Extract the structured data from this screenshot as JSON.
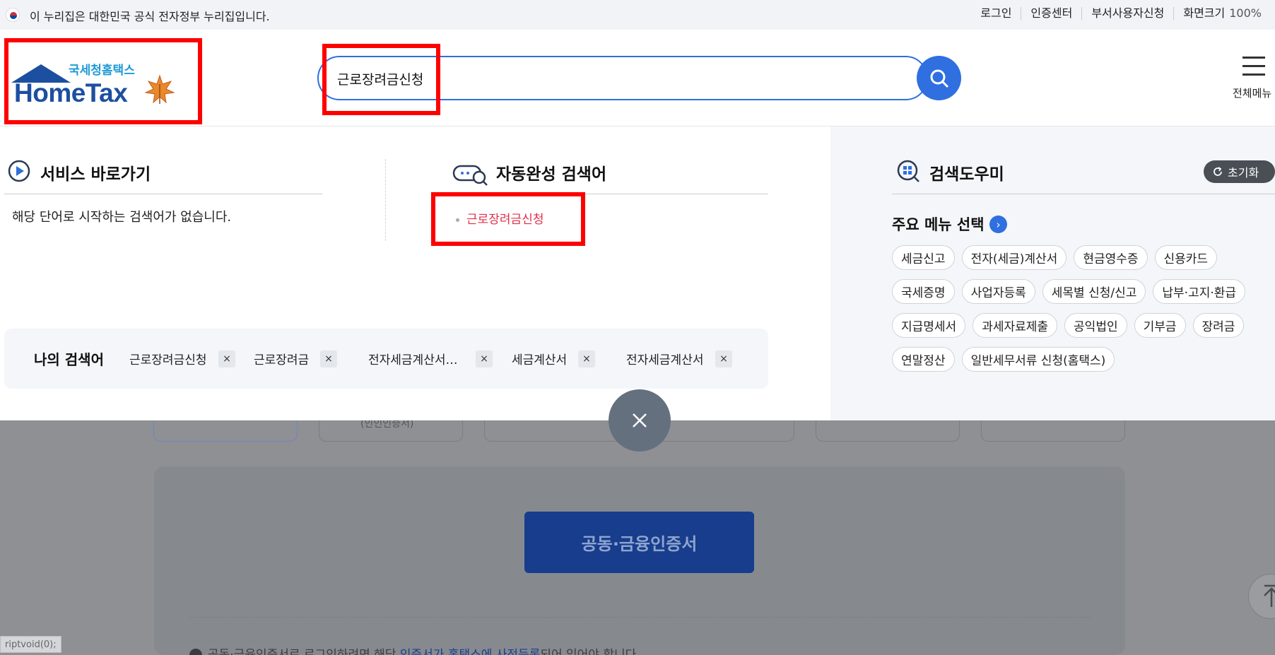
{
  "gov_banner": {
    "text": "이 누리집은 대한민국 공식 전자정부 누리집입니다.",
    "links": [
      "로그인",
      "인증센터",
      "부서사용자신청",
      "화면크기"
    ],
    "zoom": "100%"
  },
  "header": {
    "logo_sub": "국세청홈택스",
    "logo_main": "HomeTax",
    "search_value": "근로장려금신청",
    "menu_label": "전체메뉴"
  },
  "service": {
    "title": "서비스 바로가기",
    "empty_message": "해당 단어로 시작하는 검색어가 없습니다."
  },
  "autocomplete": {
    "title": "자동완성 검색어",
    "items": [
      "근로장려금신청"
    ]
  },
  "helper": {
    "title": "검색도우미",
    "reset_label": "초기화",
    "main_menu_title": "주요 메뉴 선택",
    "chips": [
      "세금신고",
      "전자(세금)계산서",
      "현금영수증",
      "신용카드",
      "국세증명",
      "사업자등록",
      "세목별 신청/신고",
      "납부·고지·환급",
      "지급명세서",
      "과세자료제출",
      "공익법인",
      "기부금",
      "장려금",
      "연말정산",
      "일반세무서류 신청(홈택스)"
    ]
  },
  "my_search": {
    "title": "나의 검색어",
    "items": [
      "근로장려금신청",
      "근로장려금",
      "전자세금계산서…",
      "세금계산서",
      "전자세금계산서"
    ]
  },
  "background": {
    "tab_partial": "(인인인증서)",
    "cert_button": "공동·금융인증서",
    "note_pre": "공동·금융인증서로 로그인하려면 해당 ",
    "note_link": "인증서가 홈택스에 사전등록",
    "note_post": "되어 있어야 합니다.",
    "status_text": "riptvoid(0);"
  },
  "colors": {
    "accent": "#2f6fe0",
    "highlight_red": "#e0304b",
    "annotation_red": "#ff0000"
  }
}
